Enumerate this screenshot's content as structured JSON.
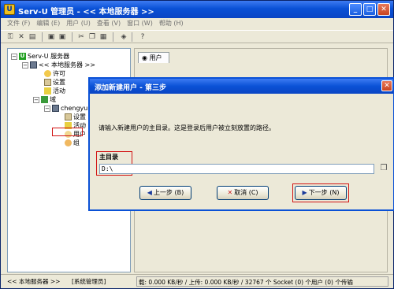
{
  "window": {
    "title": "Serv-U 管理员 - << 本地服务器 >>",
    "controls": {
      "minimize": "_",
      "maximize": "□",
      "close": "✕"
    }
  },
  "menu": [
    {
      "label": "文件 (F)"
    },
    {
      "label": "编辑 (E)"
    },
    {
      "label": "用户 (U)"
    },
    {
      "label": "查看 (V)"
    },
    {
      "label": "窗口 (W)"
    },
    {
      "label": "帮助 (H)"
    }
  ],
  "toolbar": {
    "icons": [
      "key-icon",
      "delete-icon",
      "properties-icon",
      "up-folder-icon",
      "refresh-icon",
      "cut-icon",
      "copy-icon",
      "paste-icon",
      "book-icon",
      "help-icon"
    ],
    "glyphs": [
      "⚿",
      "✕",
      "▤",
      "▣",
      "▣",
      "✂",
      "❐",
      "▦",
      "◈",
      "?"
    ]
  },
  "tree": {
    "nodes": [
      {
        "label": "Serv-U 服务器",
        "expander": "−"
      },
      {
        "label": "<< 本地服务器 >>",
        "expander": "−"
      },
      {
        "label": "许可",
        "expander": ""
      },
      {
        "label": "设置",
        "expander": ""
      },
      {
        "label": "活动",
        "expander": ""
      },
      {
        "label": "域",
        "expander": "−"
      },
      {
        "label": "chengyun",
        "expander": "−"
      },
      {
        "label": "设置",
        "expander": ""
      },
      {
        "label": "活动",
        "expander": ""
      },
      {
        "label": "用户",
        "expander": ""
      },
      {
        "label": "组",
        "expander": ""
      }
    ]
  },
  "right_panel": {
    "tab_label": "用户"
  },
  "dialog": {
    "title": "添加新建用户 - 第三步",
    "message": "请输入新建用户的主目录。这是登录后用户被立刻放置的路径。",
    "dir_label": "主目录",
    "dir_value": "D:\\",
    "buttons": {
      "prev": "上一步 (B)",
      "cancel": "取消 (C)",
      "next": "下一步 (N)"
    }
  },
  "status": {
    "server": "<< 本地服务器 >>",
    "admin": "[系统管理员]",
    "stats": "载: 0.000 KB/秒 / 上传: 0.000 KB/秒 / 32767 个 Socket (0) 个用户 (0) 个传输"
  }
}
